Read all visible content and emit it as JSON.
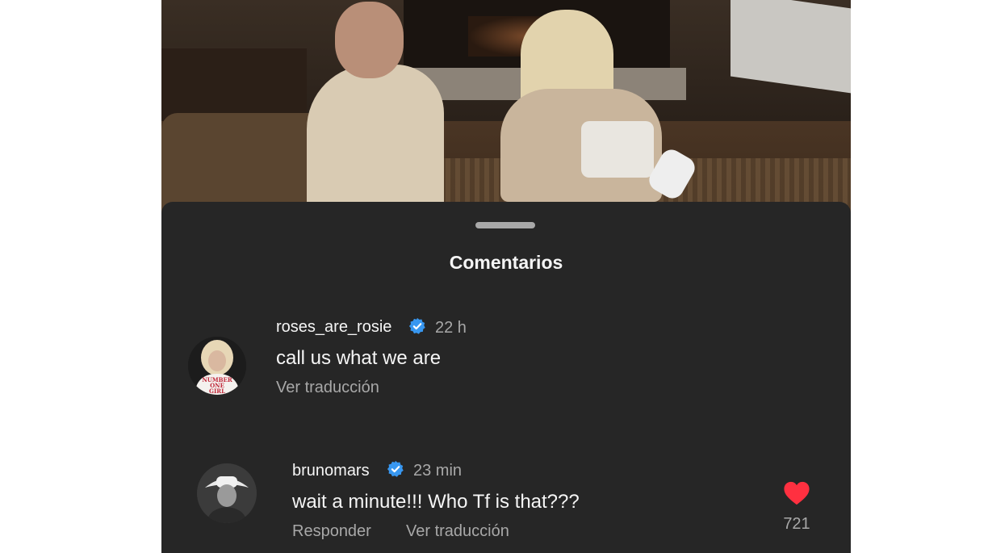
{
  "sheet": {
    "title": "Comentarios"
  },
  "comments": [
    {
      "username": "roses_are_rosie",
      "verified": true,
      "time": "22 h",
      "text": "call us what we are",
      "translate_label": "Ver traducción",
      "avatar_shirt_text": "NUMBER ONE GIRL"
    },
    {
      "username": "brunomars",
      "verified": true,
      "time": "23 min",
      "text": "wait a minute!!! Who Tf is that???",
      "reply_label": "Responder",
      "translate_label": "Ver traducción",
      "like_count": "721"
    }
  ],
  "colors": {
    "sheet_bg": "#262626",
    "verified_blue": "#3897f0",
    "like_red": "#ff3040",
    "secondary_text": "#a8a8a8"
  }
}
